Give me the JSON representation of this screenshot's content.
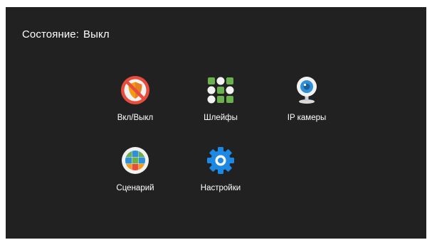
{
  "status": {
    "label": "Состояние:",
    "value": "Выкл"
  },
  "tiles": [
    {
      "label": "Вкл/Выкл",
      "icon": "shield-off-icon"
    },
    {
      "label": "Шлейфы",
      "icon": "zones-grid-icon"
    },
    {
      "label": "IP камеры",
      "icon": "webcam-icon"
    },
    {
      "label": "Сценарий",
      "icon": "scenario-grid-icon"
    },
    {
      "label": "Настройки",
      "icon": "gear-icon"
    }
  ],
  "colors": {
    "background": "#212121",
    "text": "#ffffff",
    "shield_red": "#e74c3c",
    "shield_orange": "#f39c12",
    "green": "#6ab04c",
    "camera_blue": "#2f8fd8",
    "gear_blue": "#1e88e5"
  }
}
